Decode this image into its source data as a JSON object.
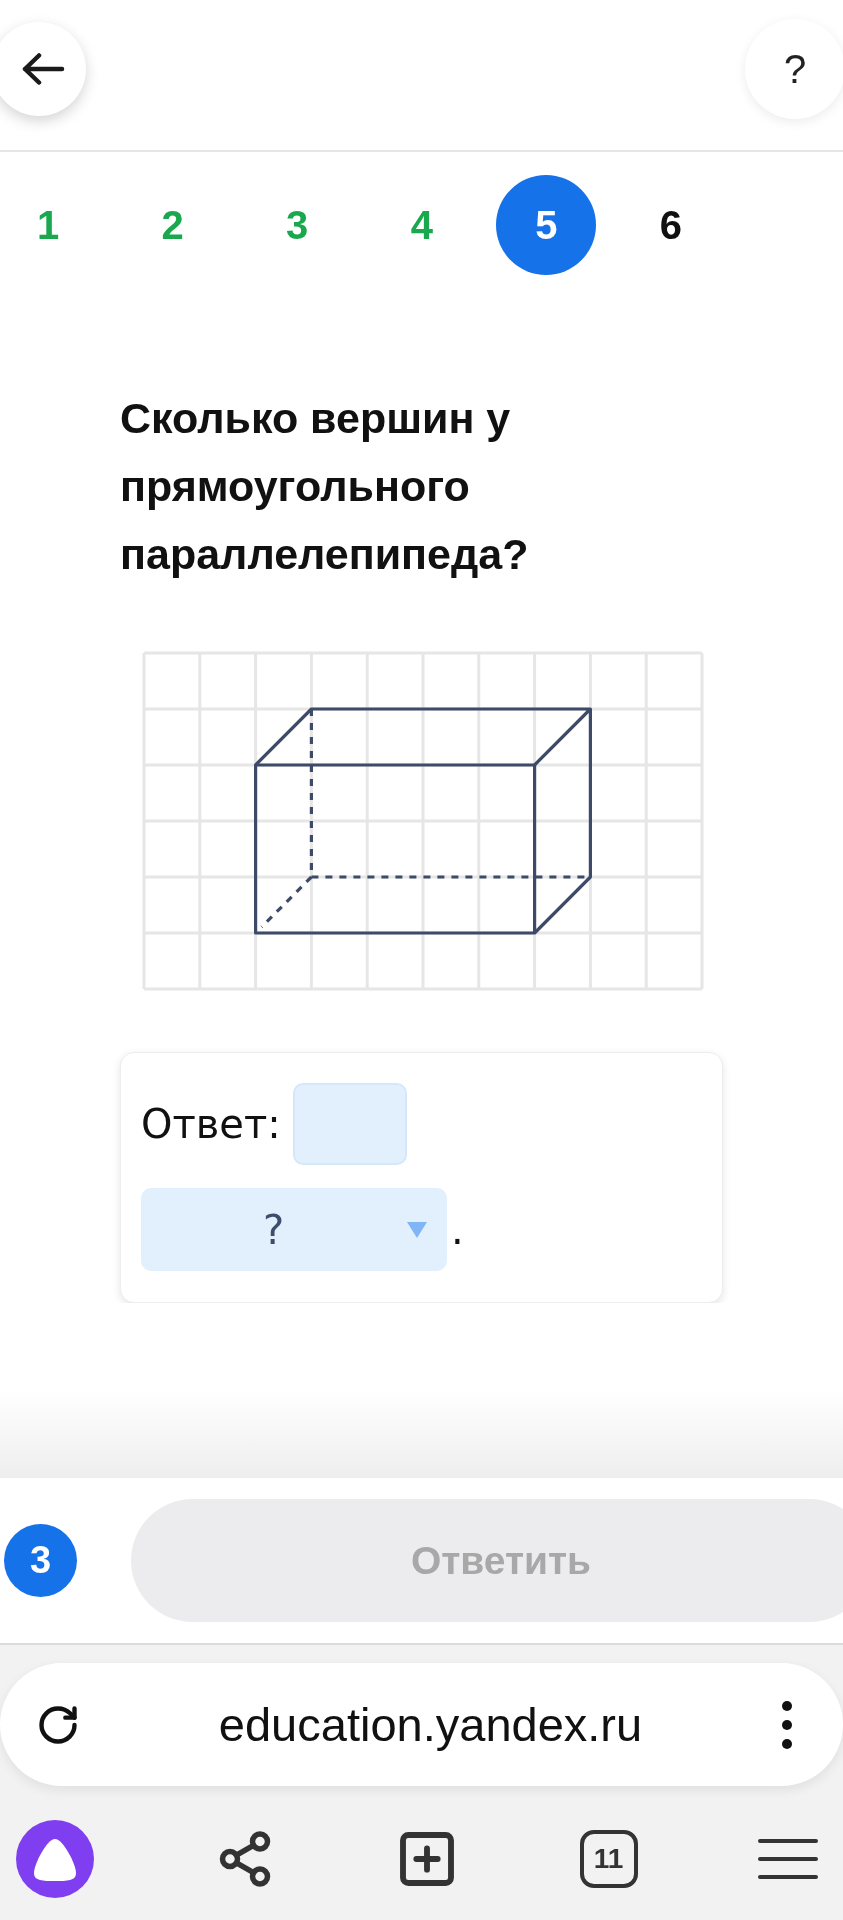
{
  "header": {
    "help": "?"
  },
  "steps": [
    {
      "label": "1",
      "done": true,
      "selected": false
    },
    {
      "label": "2",
      "done": true,
      "selected": false
    },
    {
      "label": "3",
      "done": true,
      "selected": false
    },
    {
      "label": "4",
      "done": true,
      "selected": false
    },
    {
      "label": "5",
      "done": false,
      "selected": true
    },
    {
      "label": "6",
      "done": false,
      "selected": false
    }
  ],
  "question": "Сколько вершин у прямоугольного параллелепипеда?",
  "answer": {
    "label": "Ответ:",
    "dropdown": {
      "placeholder": "?"
    },
    "end": "."
  },
  "footer": {
    "badge": "3",
    "submit": {
      "label": "Ответить",
      "disabled": true
    }
  },
  "browser": {
    "url": "education.yandex.ru",
    "tab_count": "11"
  }
}
